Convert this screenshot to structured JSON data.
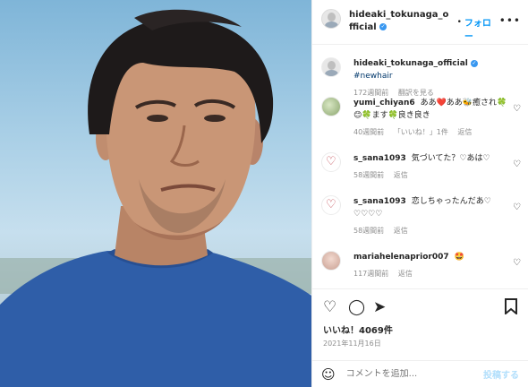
{
  "header": {
    "username": "hideaki_tokunaga_official",
    "dot": "•",
    "follow_label": "フォロー",
    "more_label": "•••"
  },
  "caption": {
    "username": "hideaki_tokunaga_official",
    "hashtag": "#newhair",
    "time": "172週間前",
    "translate": "翻訳を見る"
  },
  "comments": [
    {
      "username": "yumi_chiyan6",
      "text": "ああ❤️ああ🐝癒され🍀😊🍀ます🍀良き良き",
      "time": "40週間前",
      "likes": "「いいね！」1件",
      "reply": "返信"
    },
    {
      "username": "s_sana1093",
      "text": "気づいてた？♡あは♡",
      "time": "58週間前",
      "reply": "返信"
    },
    {
      "username": "s_sana1093",
      "text": "恋しちゃったんだあ♡ ♡♡♡♡",
      "time": "58週間前",
      "reply": "返信"
    },
    {
      "username": "mariahelenaprior007",
      "text": "🤩",
      "time": "117週間前",
      "reply": "返信"
    }
  ],
  "actions": {
    "likes": "いいね！4069件",
    "date": "2021年11月16日"
  },
  "add_comment": {
    "placeholder": "コメントを追加...",
    "post_label": "投稿する"
  }
}
